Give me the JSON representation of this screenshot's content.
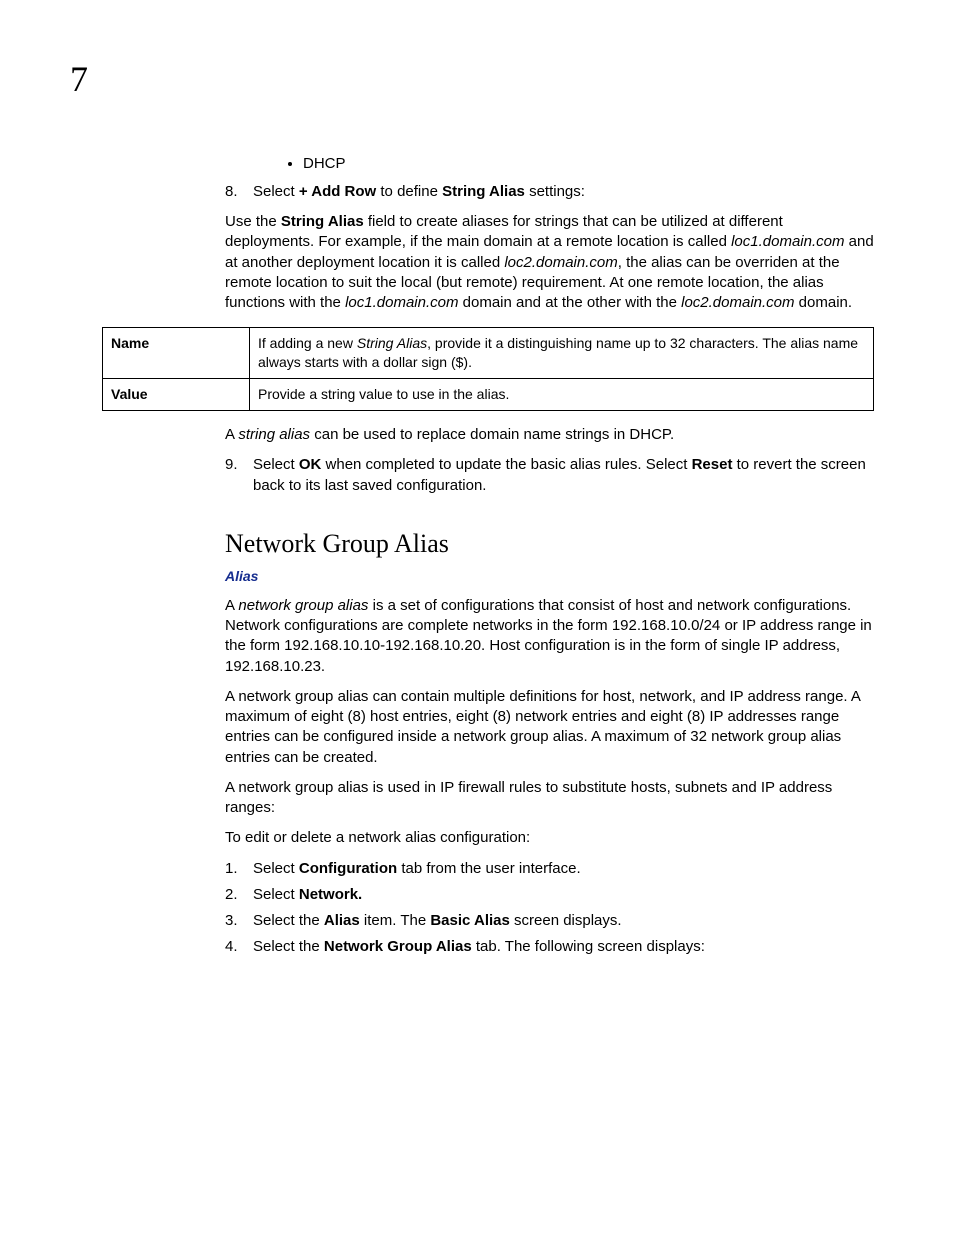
{
  "page": {
    "chapter_number": "7"
  },
  "bullet": {
    "item1": "DHCP"
  },
  "step8": {
    "number": "8.",
    "pre": "Select ",
    "bold1": "+ Add Row",
    "mid": " to define ",
    "bold2": "String Alias",
    "post": " settings:"
  },
  "para1": {
    "t1": "Use the ",
    "b1": "String Alias",
    "t2": " field to create aliases for strings that can be utilized at different deployments. For example, if the main domain at a remote location is called ",
    "i1": "loc1.domain.com",
    "t3": " and at another deployment location it is called ",
    "i2": "loc2.domain.com",
    "t4": ", the alias can be overriden at the remote location to suit the local (but remote) requirement. At one remote location, the alias functions with the ",
    "i3": "loc1.domain.com",
    "t5": " domain and at the other with the ",
    "i4": "loc2.domain.com",
    "t6": " domain."
  },
  "table": {
    "row1": {
      "term": "Name",
      "d1": "If adding a new ",
      "di1": "String Alias",
      "d2": ", provide it a distinguishing name up to 32 characters. The alias name always starts with a dollar sign ($)."
    },
    "row2": {
      "term": "Value",
      "desc": "Provide a string value to use in the alias."
    }
  },
  "para2": {
    "t1": "A ",
    "i1": "string alias",
    "t2": " can be used to replace domain name strings in DHCP."
  },
  "step9": {
    "number": "9.",
    "t1": "Select ",
    "b1": "OK",
    "t2": " when completed to update the basic alias rules. Select ",
    "b2": "Reset",
    "t3": " to revert the screen back to its last saved configuration."
  },
  "section": {
    "heading": "Network Group Alias",
    "breadcrumb": "Alias"
  },
  "para3": {
    "t1": "A ",
    "i1": "network group alias",
    "t2": " is a set of configurations that consist of host and network configurations. Network configurations are complete networks in the form 192.168.10.0/24 or IP address range in the form 192.168.10.10-192.168.10.20. Host configuration is in the form of single IP address, 192.168.10.23."
  },
  "para4": "A network group alias can contain multiple definitions for host, network, and IP address range. A maximum of eight (8) host entries, eight (8) network entries and eight (8) IP addresses range entries can be configured inside a network group alias. A maximum of 32 network group alias entries can be created.",
  "para5": "A network group alias is used in IP firewall rules to substitute hosts, subnets and IP address ranges:",
  "para6": "To edit or delete a network alias configuration:",
  "steps2": {
    "s1": {
      "n": "1.",
      "t1": "Select ",
      "b1": "Configuration",
      "t2": " tab from the user interface."
    },
    "s2": {
      "n": "2.",
      "t1": "Select ",
      "b1": "Network.",
      "t2": ""
    },
    "s3": {
      "n": "3.",
      "t1": "Select the ",
      "b1": "Alias",
      "t2": " item. The ",
      "b2": "Basic Alias",
      "t3": " screen displays."
    },
    "s4": {
      "n": "4.",
      "t1": "Select the ",
      "b1": "Network Group Alias",
      "t2": " tab. The following screen displays:"
    }
  }
}
